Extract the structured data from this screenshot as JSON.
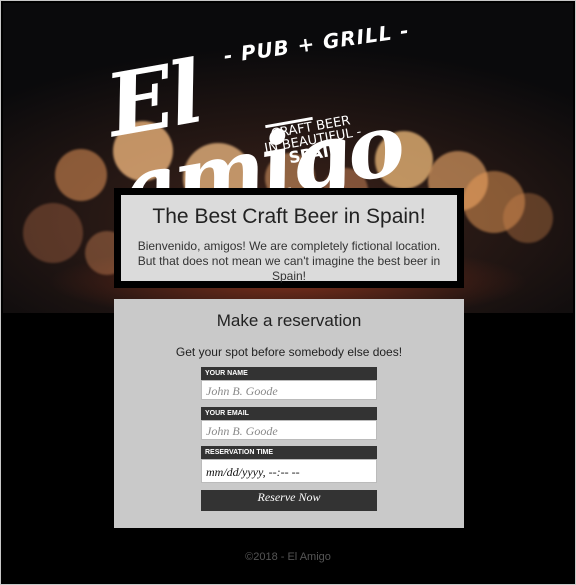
{
  "logo": {
    "pub_grill": "- PUB + GRILL -",
    "name": "El amigo",
    "tagline_line1": "CRAFT BEER",
    "tagline_line2": "IN BEAUTIFUL -",
    "tagline_line3": "SPAIN"
  },
  "headline": {
    "title": "The Best Craft Beer in Spain!",
    "text": "Bienvenido, amigos! We are completely fictional location. But that does not mean we can't imagine the best beer in Spain!"
  },
  "reservation": {
    "title": "Make a reservation",
    "subtitle": "Get your spot before somebody else does!",
    "name_label": "YOUR NAME",
    "name_placeholder": "John B. Goode",
    "email_label": "YOUR EMAIL",
    "email_placeholder": "John B. Goode",
    "time_label": "RESERVATION TIME",
    "time_value": "mm/dd/yyyy, --:-- --",
    "submit_label": "Reserve Now"
  },
  "footer": {
    "text": "©2018 - El Amigo"
  },
  "colors": {
    "form_bg": "#c9c9c9",
    "dark": "#333333",
    "headline_border": "#000000"
  }
}
